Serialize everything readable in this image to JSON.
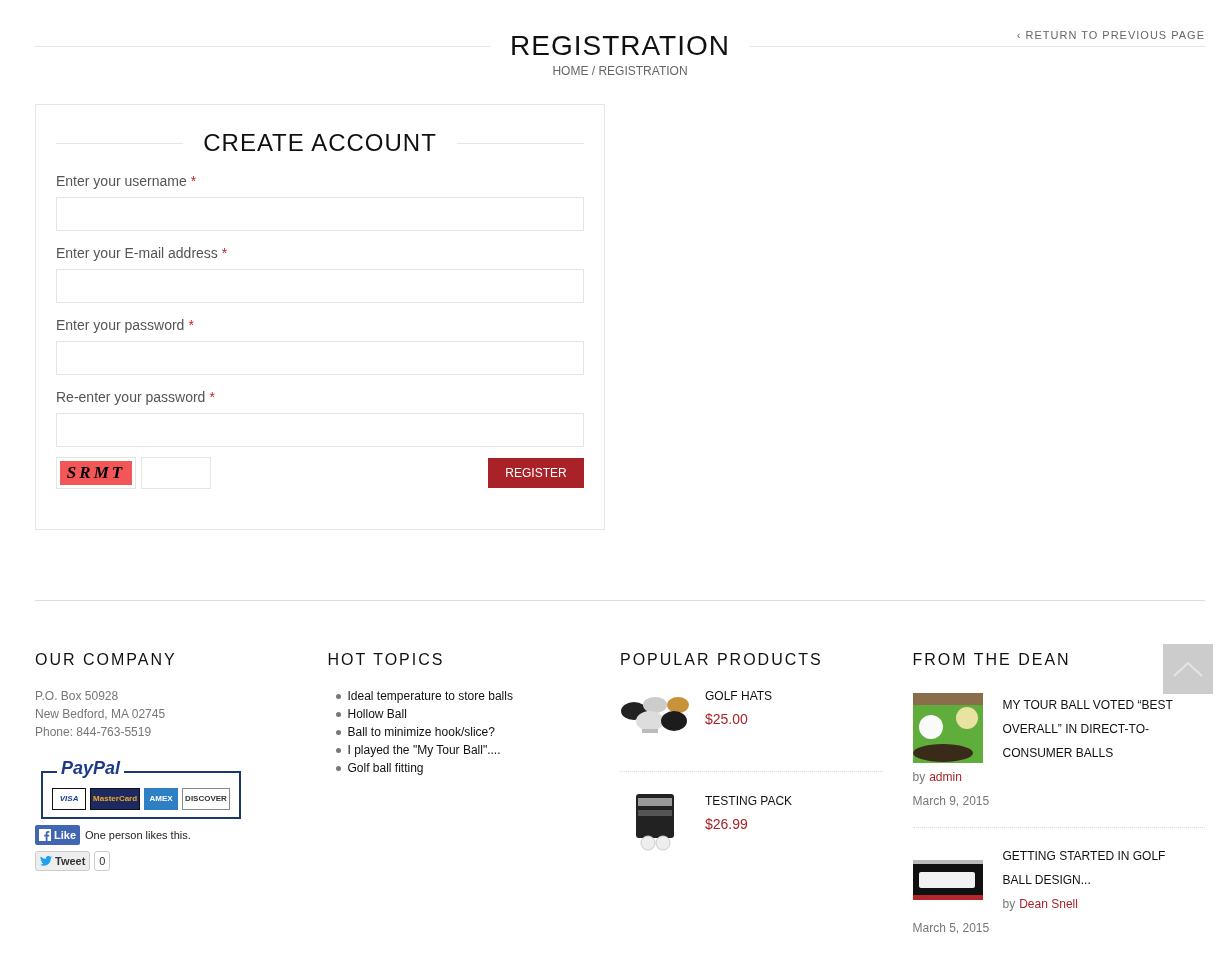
{
  "header": {
    "title": "REGISTRATION",
    "breadcrumb": "HOME / REGISTRATION",
    "return_link": {
      "icon": "‹",
      "label": "RETURN TO PREVIOUS PAGE"
    }
  },
  "form": {
    "title": "CREATE ACCOUNT",
    "fields": [
      {
        "label": "Enter your username",
        "mark": "*"
      },
      {
        "label": "Enter your E-mail address",
        "mark": "*"
      },
      {
        "label": "Enter your password",
        "mark": "*"
      },
      {
        "label": "Re-enter your password",
        "mark": "*"
      }
    ],
    "captcha": "SRMT",
    "submit": "REGISTER"
  },
  "footer": {
    "company": {
      "title": "OUR COMPANY",
      "lines": [
        "P.O. Box 50928",
        "New Bedford, MA 02745",
        "Phone: 844-763-5519"
      ],
      "payment": {
        "brand": "PayPal",
        "cards": [
          {
            "label": "VISA",
            "kind": "visa"
          },
          {
            "label": "MasterCard",
            "kind": "mastercard"
          },
          {
            "label": "AMEX",
            "kind": "amex"
          },
          {
            "label": "DISCOVER",
            "kind": "discover"
          }
        ]
      },
      "like": {
        "label": "Like",
        "text": "One person likes this."
      },
      "tweet": {
        "label": "Tweet",
        "count": "0"
      }
    },
    "topics": {
      "title": "HOT TOPICS",
      "items": [
        "Ideal temperature to store balls",
        "Hollow Ball",
        "Ball to minimize hook/slice?",
        "I played the \"My Tour Ball\"....",
        "Golf ball fitting"
      ]
    },
    "products": {
      "title": "POPULAR PRODUCTS",
      "items": [
        {
          "name": "GOLF HATS",
          "price": "$25.00",
          "kind": "hats"
        },
        {
          "name": "TESTING PACK",
          "price": "$26.99",
          "kind": "pack"
        }
      ]
    },
    "dean": {
      "title": "FROM THE DEAN",
      "posts": [
        {
          "title": "MY TOUR BALL VOTED “BEST OVERALL” IN DIRECT-TO-CONSUMER BALLS",
          "by": "by",
          "author": "admin",
          "date": "March 9, 2015",
          "kind": "golf"
        },
        {
          "title": "GETTING STARTED IN GOLF BALL DESIGN...",
          "by": "by",
          "author": "Dean Snell",
          "date": "March 5, 2015",
          "kind": "dark"
        }
      ]
    }
  }
}
